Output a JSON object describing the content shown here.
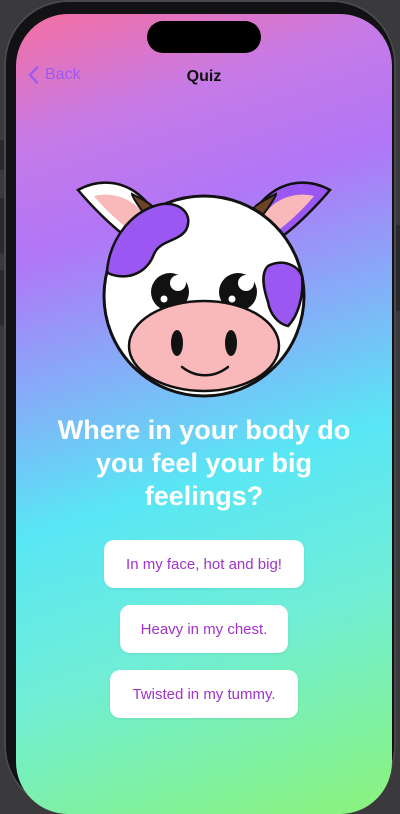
{
  "nav": {
    "back_label": "Back",
    "title": "Quiz"
  },
  "quiz": {
    "question": "Where in your body do you feel your big feelings?",
    "answers": [
      "In my face, hot and big!",
      "Heavy in my chest.",
      "Twisted in my tummy."
    ]
  },
  "colors": {
    "accent": "#9b5bf0",
    "answer_text": "#a133c9",
    "cow_spot": "#9a57f2",
    "snout": "#f9b9bb"
  },
  "icons": {
    "back": "chevron-left-icon",
    "mascot": "cow-illustration"
  }
}
